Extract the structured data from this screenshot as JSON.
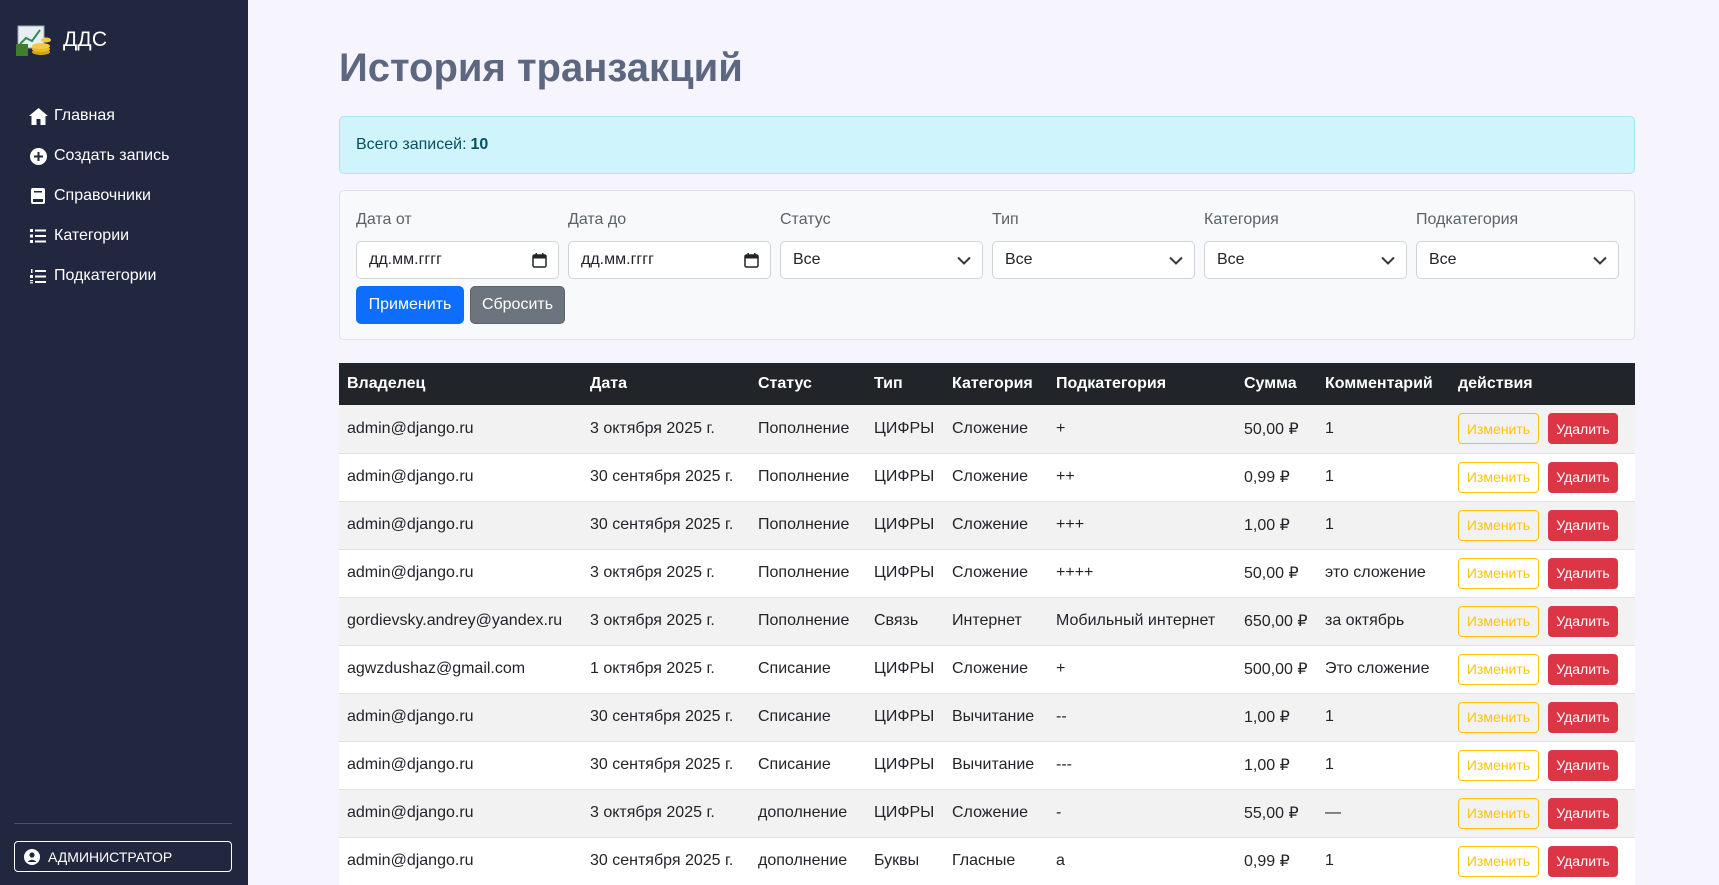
{
  "sidebar": {
    "brand": "ДДС",
    "items": [
      {
        "label": "Главная",
        "icon": "home-icon"
      },
      {
        "label": "Создать запись",
        "icon": "plus-circle-icon"
      },
      {
        "label": "Справочники",
        "icon": "book-icon"
      },
      {
        "label": "Категории",
        "icon": "list-icon"
      },
      {
        "label": "Подкатегории",
        "icon": "list-ol-icon"
      }
    ],
    "user_button": "АДМИНИСТРАТОР"
  },
  "main": {
    "title": "История транзакций",
    "info": {
      "label": "Всего записей:",
      "count": "10"
    }
  },
  "filters": {
    "date_from": {
      "label": "Дата от",
      "value": "дд.мм.гггг"
    },
    "date_to": {
      "label": "Дата до",
      "value": "дд.мм.гггг"
    },
    "status": {
      "label": "Статус",
      "value": "Все"
    },
    "type": {
      "label": "Тип",
      "value": "Все"
    },
    "category": {
      "label": "Категория",
      "value": "Все"
    },
    "subcategory": {
      "label": "Подкатегория",
      "value": "Все"
    },
    "apply_label": "Применить",
    "reset_label": "Сбросить"
  },
  "table": {
    "headers": [
      "Владелец",
      "Дата",
      "Статус",
      "Тип",
      "Категория",
      "Подкатегория",
      "Сумма",
      "Комментарий",
      "действия"
    ],
    "edit_label": "Изменить",
    "delete_label": "Удалить",
    "rows": [
      [
        "admin@django.ru",
        "3 октября 2025 г.",
        "Пополнение",
        "ЦИФРЫ",
        "Сложение",
        "+",
        "50,00 ₽",
        "1"
      ],
      [
        "admin@django.ru",
        "30 сентября 2025 г.",
        "Пополнение",
        "ЦИФРЫ",
        "Сложение",
        "++",
        "0,99 ₽",
        "1"
      ],
      [
        "admin@django.ru",
        "30 сентября 2025 г.",
        "Пополнение",
        "ЦИФРЫ",
        "Сложение",
        "+++",
        "1,00 ₽",
        "1"
      ],
      [
        "admin@django.ru",
        "3 октября 2025 г.",
        "Пополнение",
        "ЦИФРЫ",
        "Сложение",
        "++++",
        "50,00 ₽",
        "это сложение"
      ],
      [
        "gordievsky.andrey@yandex.ru",
        "3 октября 2025 г.",
        "Пополнение",
        "Связь",
        "Интернет",
        "Мобильный интернет",
        "650,00 ₽",
        "за октябрь"
      ],
      [
        "agwzdushaz@gmail.com",
        "1 октября 2025 г.",
        "Списание",
        "ЦИФРЫ",
        "Сложение",
        "+",
        "500,00 ₽",
        "Это сложение"
      ],
      [
        "admin@django.ru",
        "30 сентября 2025 г.",
        "Списание",
        "ЦИФРЫ",
        "Вычитание",
        "--",
        "1,00 ₽",
        "1"
      ],
      [
        "admin@django.ru",
        "30 сентября 2025 г.",
        "Списание",
        "ЦИФРЫ",
        "Вычитание",
        "---",
        "1,00 ₽",
        "1"
      ],
      [
        "admin@django.ru",
        "3 октября 2025 г.",
        "дополнение",
        "ЦИФРЫ",
        "Сложение",
        "-",
        "55,00 ₽",
        "—"
      ],
      [
        "admin@django.ru",
        "30 сентября 2025 г.",
        "дополнение",
        "Буквы",
        "Гласные",
        "а",
        "0,99 ₽",
        "1"
      ]
    ]
  },
  "colors": {
    "sidebar_bg": "#222740",
    "page_bg": "#f6f4fc",
    "primary": "#0d6efd",
    "secondary": "#6c757d",
    "warning": "#ffc107",
    "danger": "#dc3545",
    "info_bg": "#cff4fc"
  }
}
